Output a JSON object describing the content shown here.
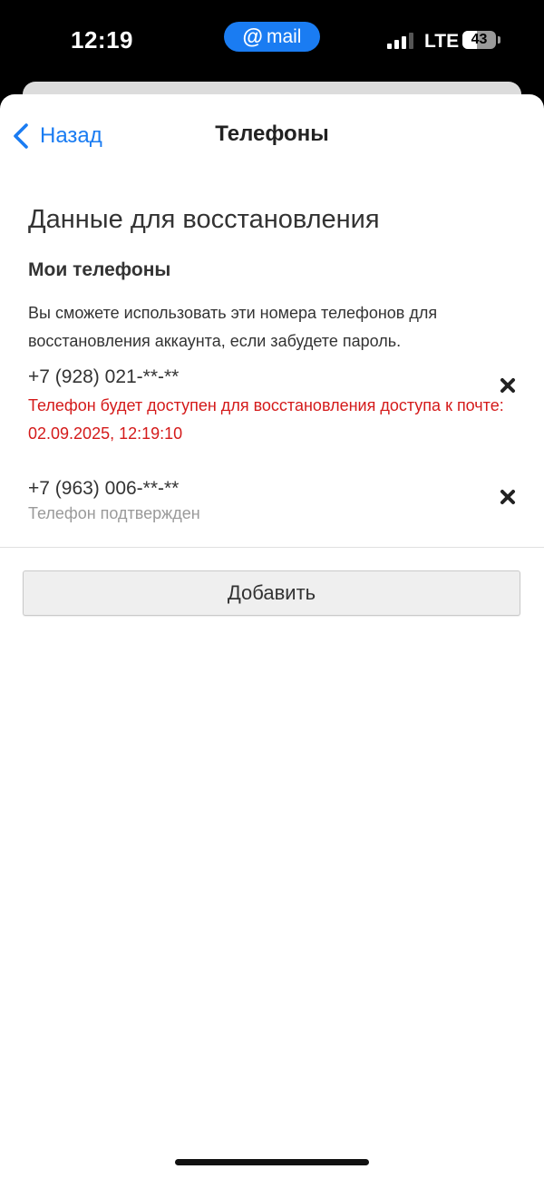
{
  "status_bar": {
    "time": "12:19",
    "app_pill": {
      "at_symbol": "@",
      "label": "mail",
      "color": "#1a7cf2"
    },
    "network": "LTE",
    "battery_level": "43",
    "icons": [
      "signal-icon",
      "battery-icon"
    ]
  },
  "nav": {
    "back_label": "Назад",
    "title": "Телефоны",
    "accent_color": "#1a7cf2"
  },
  "content": {
    "section_title": "Данные для восстановления",
    "subsection_title": "Мои телефоны",
    "description": "Вы сможете использовать эти номера телефонов для восстановления аккаунта, если забудете пароль.",
    "phones": [
      {
        "number": "+7 (928) 021-**-**",
        "status": "Телефон будет доступен для восстановления доступа к почте: 02.09.2025, 12:19:10",
        "status_color": "#d41a1a"
      },
      {
        "number": "+7 (963) 006-**-**",
        "status": "Телефон подтвержден",
        "status_color": "#9a9a9a"
      }
    ],
    "add_button_label": "Добавить"
  }
}
